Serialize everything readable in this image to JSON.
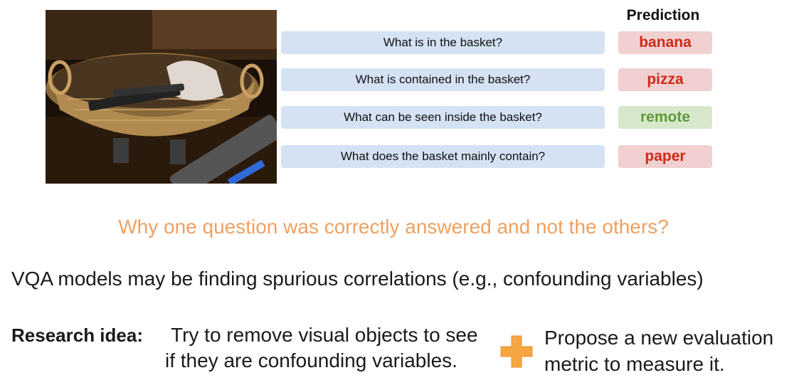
{
  "image": {
    "icon": "basket-remote-photo"
  },
  "prediction_header": "Prediction",
  "rows": [
    {
      "question": "What is in the basket?",
      "answer": "banana",
      "correct": false
    },
    {
      "question": "What is contained in the basket?",
      "answer": "pizza",
      "correct": false
    },
    {
      "question": "What can be seen inside the basket?",
      "answer": "remote",
      "correct": true
    },
    {
      "question": "What does the basket mainly contain?",
      "answer": "paper",
      "correct": false
    }
  ],
  "colors": {
    "question_bg": "#d4e2f4",
    "wrong_bg": "#f0d0d0",
    "wrong_text": "#d02a18",
    "right_bg": "#d7e7cc",
    "right_text": "#5f9a37",
    "highlight": "#f0a060",
    "plus": "#f5a642"
  },
  "why_text": "Why one question was correctly answered and not the others?",
  "claim": "VQA models may be finding spurious correlations (e.g., confounding variables)",
  "research_idea": {
    "label": "Research idea:",
    "line1": "Try to remove visual objects to see",
    "line2": "if they are confounding variables."
  },
  "plus_icon": "plus-icon",
  "proposal": {
    "line1": "Propose a new evaluation",
    "line2": "metric to measure it."
  }
}
